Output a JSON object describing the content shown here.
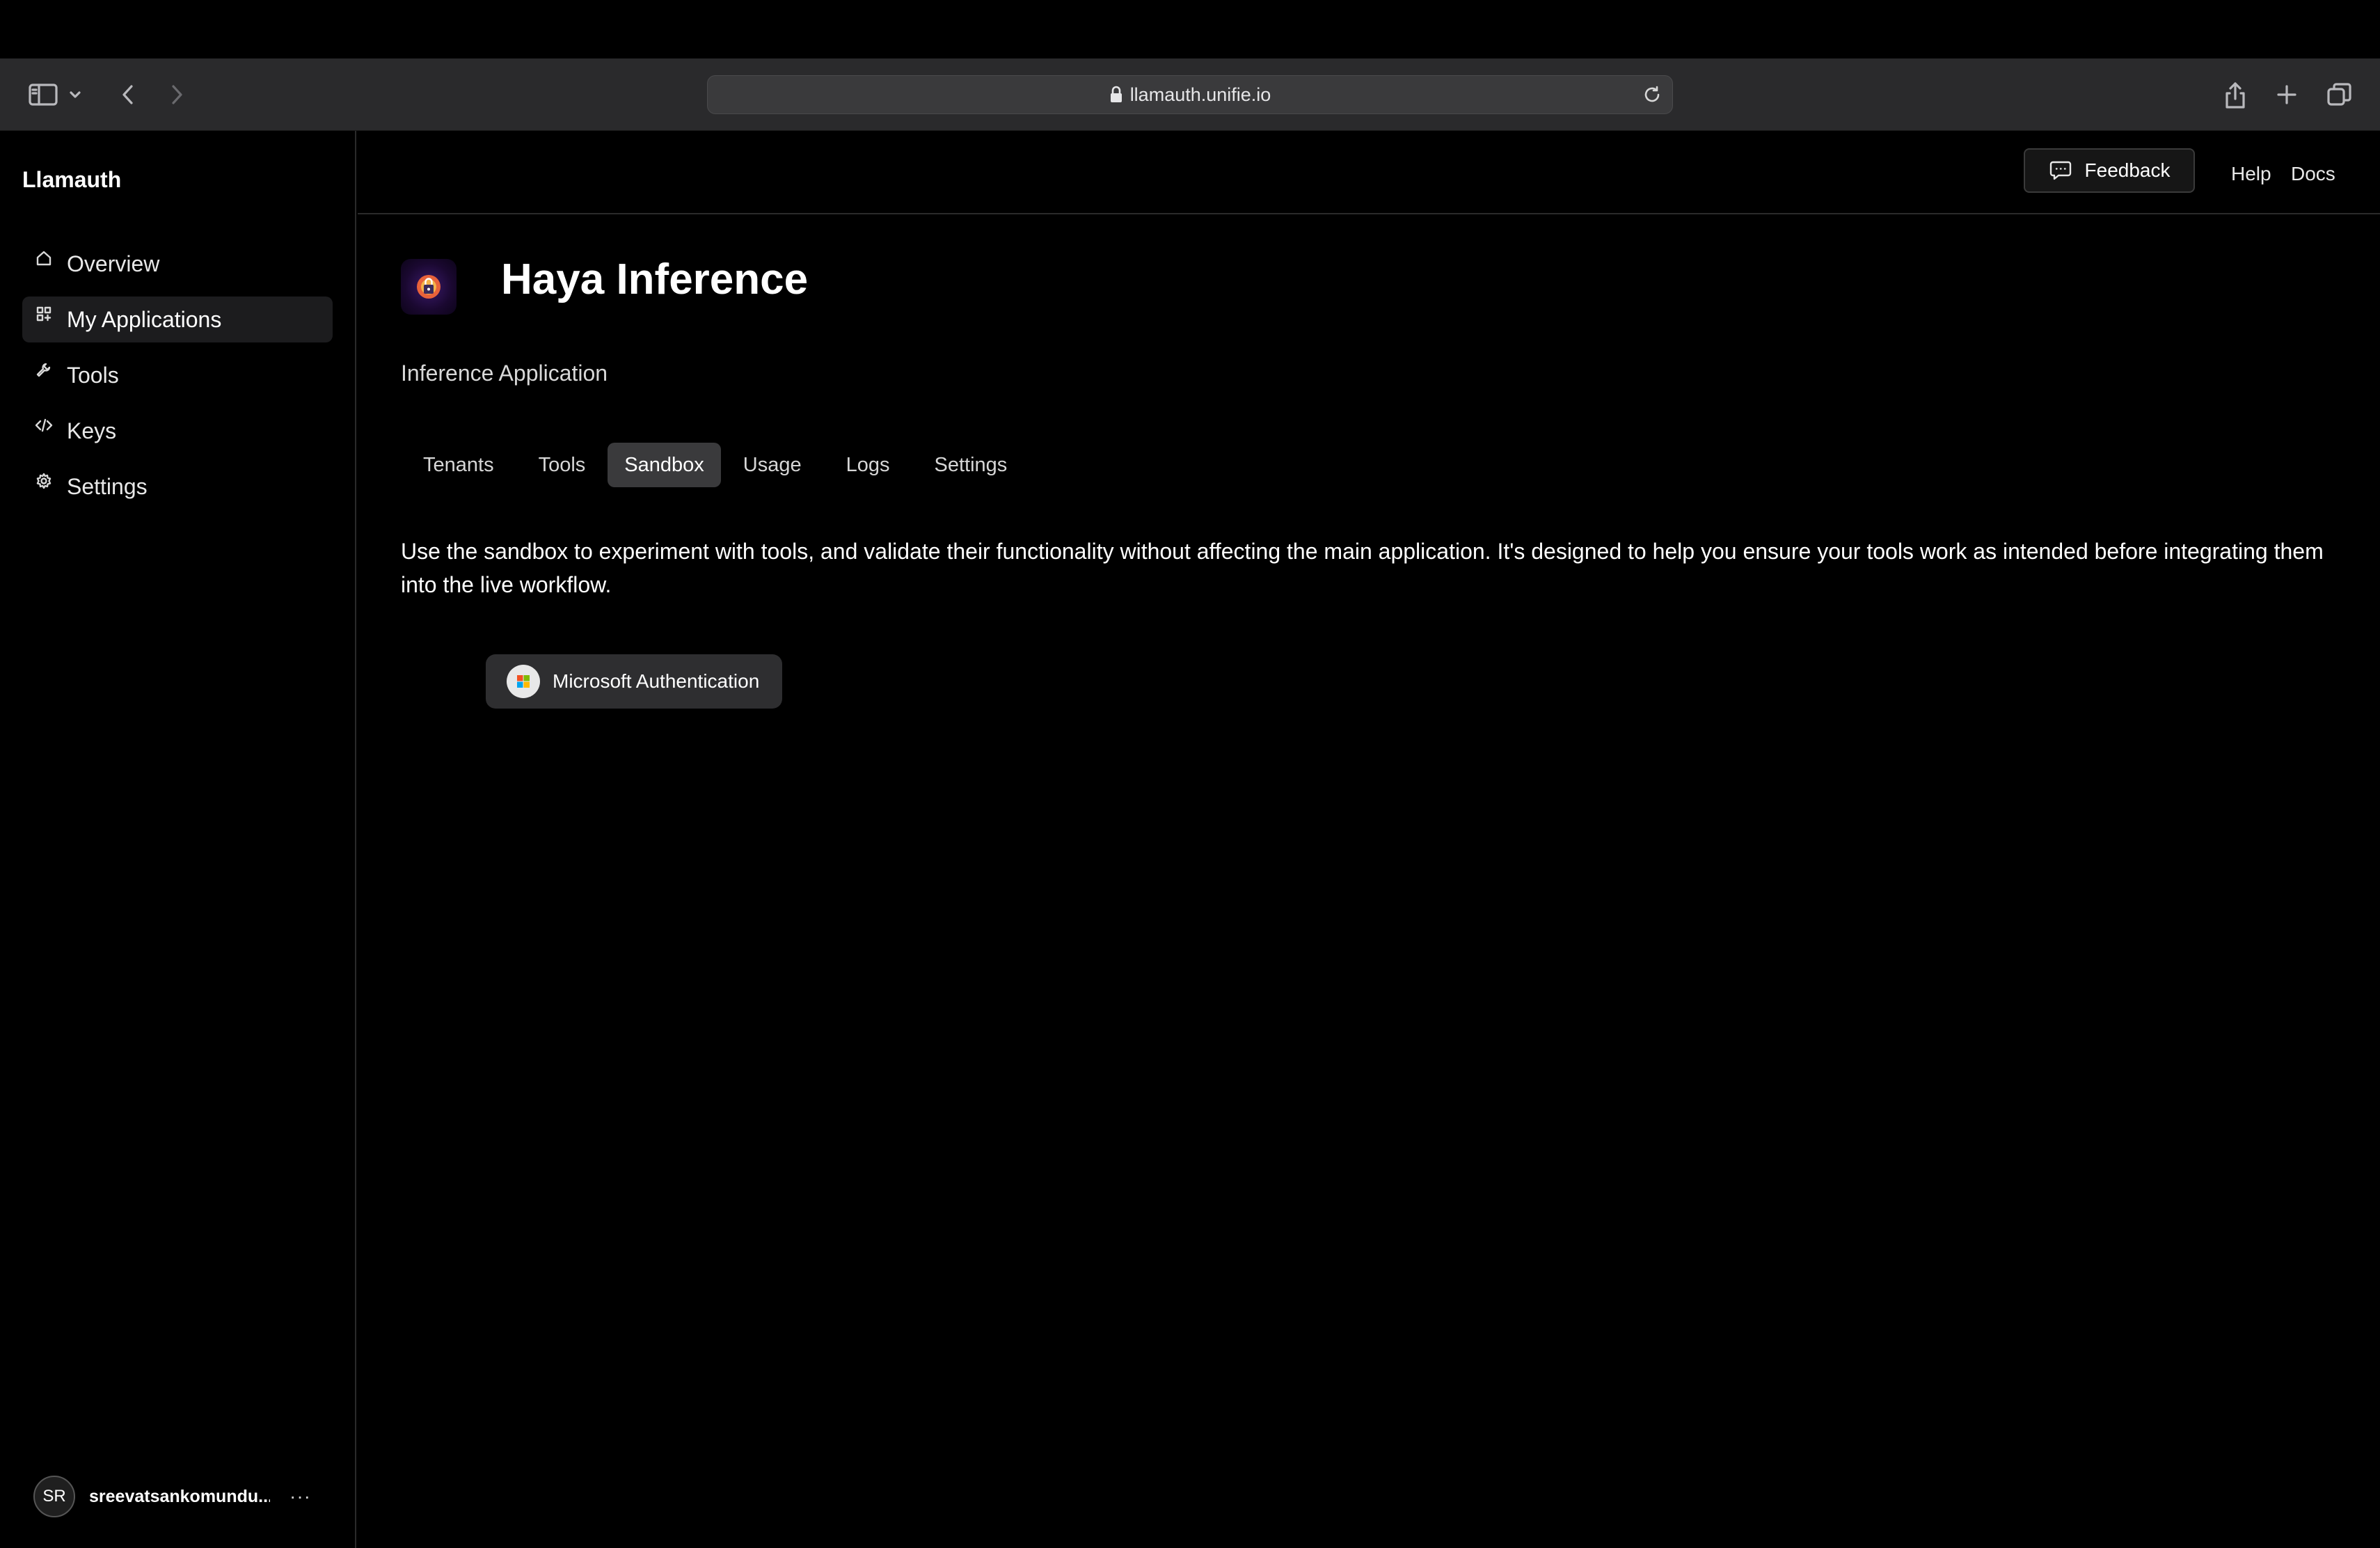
{
  "browser": {
    "url": "llamauth.unifie.io",
    "icons": {
      "sidebar_toggle": "sidebar-icon",
      "chevron": "chevron-down-icon",
      "back": "back-arrow-icon",
      "forward": "forward-arrow-icon",
      "share": "share-icon",
      "new_tab": "plus-icon",
      "tabs": "tabs-overview-icon",
      "lock": "lock-icon",
      "reload": "reload-icon"
    }
  },
  "sidebar": {
    "brand": "Llamauth",
    "items": [
      {
        "label": "Overview",
        "icon": "home-icon",
        "active": false
      },
      {
        "label": "My Applications",
        "icon": "grid-icon",
        "active": true
      },
      {
        "label": "Tools",
        "icon": "wrench-icon",
        "active": false
      },
      {
        "label": "Keys",
        "icon": "code-icon",
        "active": false
      },
      {
        "label": "Settings",
        "icon": "gear-icon",
        "active": false
      }
    ],
    "user": {
      "initials": "SR",
      "name": "sreevatsankomundu...",
      "more": "···"
    }
  },
  "header": {
    "feedback_label": "Feedback",
    "help_label": "Help",
    "docs_label": "Docs"
  },
  "app": {
    "title": "Haya Inference",
    "subtitle": "Inference Application",
    "tabs": [
      "Tenants",
      "Tools",
      "Sandbox",
      "Usage",
      "Logs",
      "Settings"
    ],
    "active_tab": "Sandbox",
    "description": "Use the sandbox to experiment with tools, and validate their functionality without affecting the main application. It's designed to help you ensure your tools work as intended before integrating them into the live workflow.",
    "tool_button": "Microsoft Authentication"
  },
  "colors": {
    "background": "#000000",
    "toolbar": "#2a2a2c",
    "active_tab": "#3a3a3c",
    "active_nav": "#1c1c1e"
  }
}
